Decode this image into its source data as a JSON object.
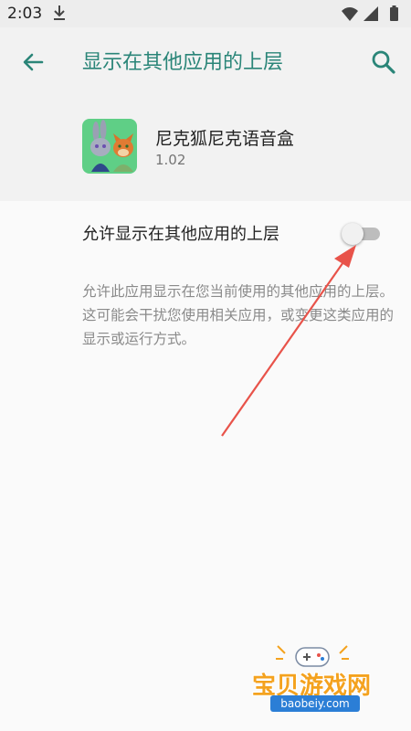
{
  "status_bar": {
    "time": "2:03"
  },
  "app_bar": {
    "title": "显示在其他应用的上层"
  },
  "app": {
    "name": "尼克狐尼克语音盒",
    "version": "1.02"
  },
  "setting": {
    "label": "允许显示在其他应用的上层",
    "enabled": false,
    "description": "允许此应用显示在您当前使用的其他应用的上层。这可能会干扰您使用相关应用，或变更这类应用的显示或运行方式。"
  },
  "icons": {
    "back": "arrow-left-icon",
    "search": "search-icon",
    "download": "download-icon",
    "wifi": "wifi-icon",
    "signal": "signal-icon",
    "battery": "battery-icon"
  },
  "colors": {
    "accent": "#2a8578",
    "annotation_arrow": "#e8534a",
    "watermark": "#f4a21e"
  },
  "watermark": {
    "brand": "宝贝游戏网",
    "url": "baobeiy.com"
  }
}
